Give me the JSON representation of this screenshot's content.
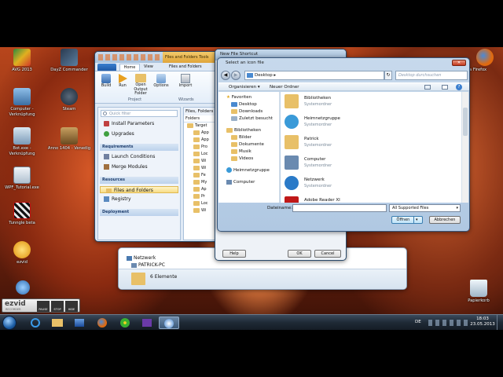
{
  "desktop": {
    "icons": [
      {
        "label": "AVG 2013"
      },
      {
        "label": "DayZ Commander"
      },
      {
        "label": "Computer - Verknüpfung"
      },
      {
        "label": "Steam"
      },
      {
        "label": "Bot.exe - Verknüpfung"
      },
      {
        "label": "Anno 1404 - Venedig"
      },
      {
        "label": "WPF_Tutorial.exe"
      },
      {
        "label": "Tunngle beta"
      },
      {
        "label": "ezvid"
      },
      {
        "label": "Papierkorb"
      },
      {
        "label": "zilla Firefox"
      }
    ]
  },
  "ezvid_bar": {
    "logo": "ezvid",
    "sub": "RECORDER",
    "pause": "PAUSE",
    "stop": "STOP",
    "hide": "HIDE"
  },
  "designer": {
    "title": "Files and Folders Tools",
    "tabs": {
      "home": "Home",
      "view": "View",
      "files": "Files and Folders"
    },
    "ribbon": {
      "build": "Build",
      "run": "Run",
      "open_output": "Open Output Folder",
      "options": "Options",
      "import": "Import"
    },
    "groups": {
      "project": "Project",
      "wizards": "Wizards"
    },
    "quick_filter_placeholder": "Quick filter",
    "nav": {
      "items_top": [
        "Install Parameters",
        "Upgrades"
      ],
      "requirements_header": "Requirements",
      "requirements_items": [
        "Launch Conditions",
        "Merge Modules"
      ],
      "resources_header": "Resources",
      "resources_items": [
        "Files and Folders",
        "Registry"
      ],
      "deployment_header": "Deployment"
    },
    "panel_header": "Files, Folders",
    "folders_label": "Folders",
    "tree": [
      "Target",
      "App",
      "App",
      "Pro",
      "Loc",
      "Wi",
      "Wi",
      "Fe",
      "My",
      "Ap",
      "Pr",
      "Loc",
      "Wi"
    ]
  },
  "shortcut_dialog": {
    "title": "New File Shortcut",
    "help": "Help",
    "ok": "OK",
    "cancel": "Cancel"
  },
  "select_dialog": {
    "title": "Select an icon file",
    "path": "Desktop",
    "search_placeholder": "Desktop durchsuchen",
    "organize": "Organisieren ▾",
    "new_folder": "Neuer Ordner",
    "nav": {
      "favoriten": "Favoriten",
      "fav_items": [
        "Desktop",
        "Downloads",
        "Zuletzt besucht"
      ],
      "bibliotheken": "Bibliotheken",
      "lib_items": [
        "Bilder",
        "Dokumente",
        "Musik",
        "Videos"
      ],
      "heimnetz": "Heimnetzgruppe",
      "computer": "Computer"
    },
    "items": [
      {
        "name": "Bibliotheken",
        "type": "Systemordner"
      },
      {
        "name": "Heimnetzgruppe",
        "type": "Systemordner"
      },
      {
        "name": "Patrick",
        "type": "Systemordner"
      },
      {
        "name": "Computer",
        "type": "Systemordner"
      },
      {
        "name": "Netzwerk",
        "type": "Systemordner"
      },
      {
        "name": "Adobe Reader XI",
        "type": ""
      }
    ],
    "filename_label": "Dateiname:",
    "filename_value": "",
    "filter": "All Supported Files",
    "open": "Öffnen",
    "cancel": "Abbrechen"
  },
  "explorer_bg": {
    "netzwerk": "Netzwerk",
    "pc": "PATRICK-PC",
    "count": "6 Elemente"
  },
  "tray": {
    "lang": "DE",
    "time": "18:03",
    "date": "23.05.2013"
  }
}
